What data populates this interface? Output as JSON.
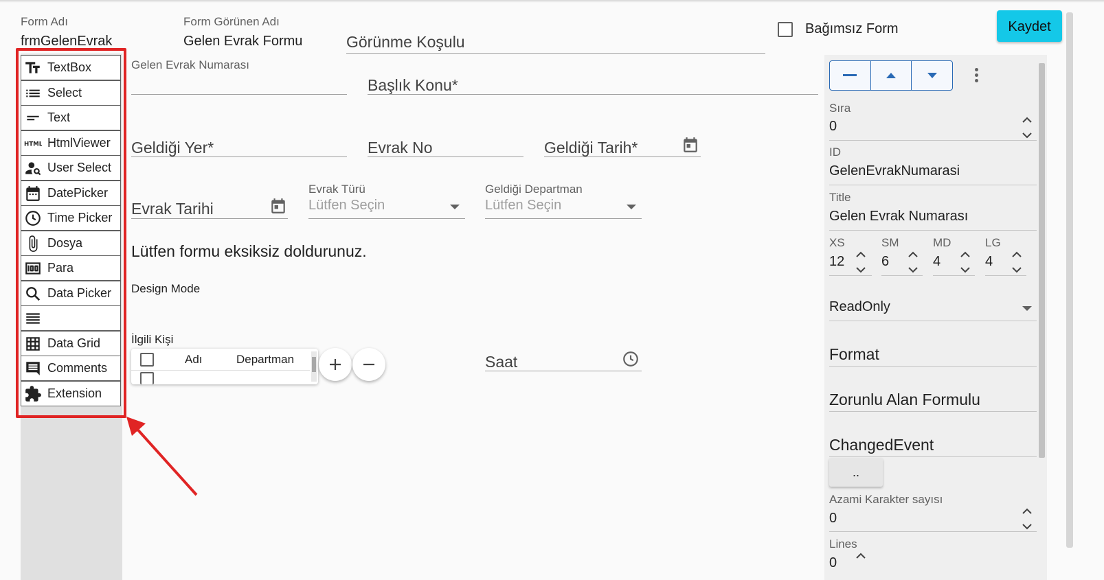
{
  "header": {
    "form_name_label": "Form Adı",
    "form_name_value": "frmGelenEvrak",
    "display_name_label": "Form Görünen Adı",
    "display_name_value": "Gelen Evrak Formu",
    "visibility_condition_placeholder": "Görünme Koşulu",
    "independent_form_label": "Bağımsız Form",
    "save_label": "Kaydet"
  },
  "toolbox": {
    "items": [
      {
        "label": "TextBox",
        "icon": "text-fields-icon"
      },
      {
        "label": "Select",
        "icon": "list-icon"
      },
      {
        "label": "Text",
        "icon": "short-text-icon"
      },
      {
        "label": "HtmlViewer",
        "icon": "html-icon"
      },
      {
        "label": "User Select",
        "icon": "person-search-icon"
      },
      {
        "label": "DatePicker",
        "icon": "calendar-icon"
      },
      {
        "label": "Time Picker",
        "icon": "clock-icon"
      },
      {
        "label": "Dosya",
        "icon": "paperclip-icon"
      },
      {
        "label": "Para",
        "icon": "money-icon"
      },
      {
        "label": "Data Picker",
        "icon": "search-icon"
      },
      {
        "label": "",
        "icon": "lines-icon"
      },
      {
        "label": "Data Grid",
        "icon": "grid-icon"
      },
      {
        "label": "Comments",
        "icon": "comment-icon"
      },
      {
        "label": "Extension",
        "icon": "puzzle-icon"
      }
    ]
  },
  "form": {
    "gelen_evrak_numarasi_label": "Gelen Evrak Numarası",
    "baslik_konu": "Başlık Konu*",
    "geldigi_yer": "Geldiği Yer*",
    "evrak_no": "Evrak No",
    "geldigi_tarih": "Geldiği Tarih*",
    "evrak_tarihi": "Evrak Tarihi",
    "evrak_turu_label": "Evrak Türü",
    "evrak_turu_placeholder": "Lütfen Seçin",
    "geldigi_departman_label": "Geldiği Departman",
    "geldigi_departman_placeholder": "Lütfen Seçin",
    "info_text": "Lütfen formu eksiksiz doldurunuz.",
    "design_mode": "Design Mode",
    "ilgili_kisi_label": "İlgili Kişi",
    "grid_col_name": "Adı",
    "grid_col_department": "Departman",
    "saat": "Saat"
  },
  "properties": {
    "sira_label": "Sıra",
    "sira_value": "0",
    "id_label": "ID",
    "id_value": "GelenEvrakNumarasi",
    "title_label": "Title",
    "title_value": "Gelen Evrak Numarası",
    "xs_label": "XS",
    "xs_value": "12",
    "sm_label": "SM",
    "sm_value": "6",
    "md_label": "MD",
    "md_value": "4",
    "lg_label": "LG",
    "lg_value": "4",
    "readonly": "ReadOnly",
    "format": "Format",
    "zorunlu_alan_formulu": "Zorunlu Alan Formulu",
    "changed_event": "ChangedEvent",
    "dots_button": "..",
    "azami_karakter_label": "Azami Karakter sayısı",
    "azami_karakter_value": "0",
    "lines_label": "Lines",
    "lines_value": "0"
  },
  "colors": {
    "save_button": "#14c8e8",
    "highlight_box": "#e02424",
    "button_group_border": "#2a6ab5"
  }
}
